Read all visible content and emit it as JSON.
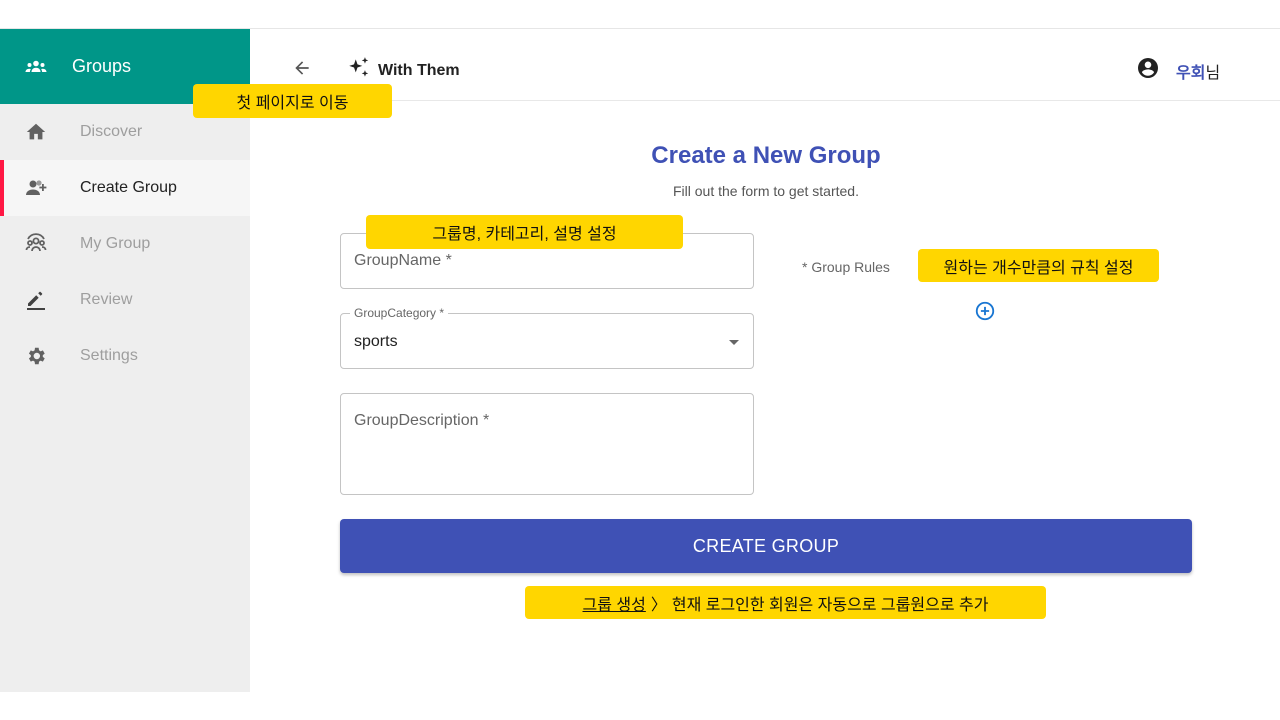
{
  "sidebar": {
    "title": "Groups",
    "icon": "groups-icon",
    "items": [
      {
        "label": "Discover",
        "icon": "home-icon",
        "active": false
      },
      {
        "label": "Create Group",
        "icon": "person-add-icon",
        "active": true
      },
      {
        "label": "My Group",
        "icon": "group-circle-icon",
        "active": false
      },
      {
        "label": "Review",
        "icon": "pencil-icon",
        "active": false
      },
      {
        "label": "Settings",
        "icon": "gear-icon",
        "active": false
      }
    ]
  },
  "header": {
    "back_icon": "arrow-left-icon",
    "brand_icon": "sparkles-icon",
    "brand": "With Them",
    "user_icon": "account-circle-icon",
    "user_name": "우회",
    "user_suffix": "님"
  },
  "form": {
    "title": "Create a New Group",
    "subtitle": "Fill out the form to get started.",
    "group_name_placeholder": "GroupName *",
    "group_category_label": "GroupCategory *",
    "group_category_value": "sports",
    "group_description_placeholder": "GroupDescription *",
    "group_rules_label": "* Group Rules",
    "add_rule_icon": "add-circle-icon",
    "submit_label": "CREATE GROUP"
  },
  "annotations": {
    "home_note": "첫 페이지로 이동",
    "fields_note": "그룹명, 카테고리, 설명 설정",
    "rules_note": "원하는 개수만큼의 규칙 설정",
    "submit_note_underlined": "그룹 생성",
    "submit_note_sep": "〉",
    "submit_note_rest": "현재 로그인한 회원은 자동으로 그룹원으로 추가"
  },
  "colors": {
    "sidebar_header": "#009688",
    "primary": "#3f51b5",
    "active_indicator": "#ff1744",
    "annotation": "#ffd600",
    "sidebar_bg": "#eeeeee"
  }
}
